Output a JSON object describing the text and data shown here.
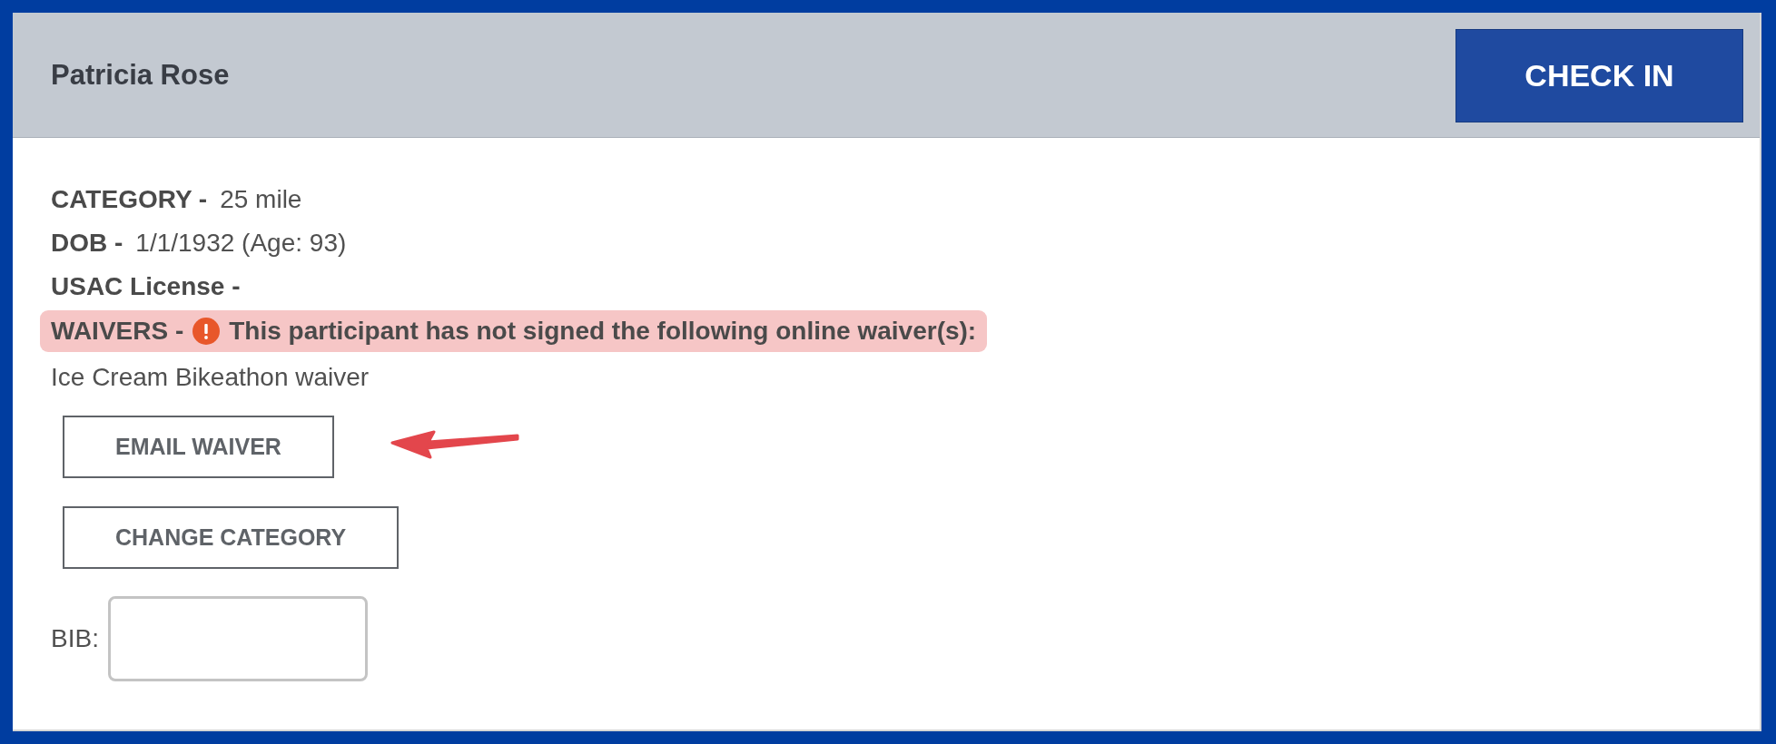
{
  "header": {
    "name": "Patricia Rose",
    "check_in_button": "CHECK IN"
  },
  "details": [
    {
      "label": "CATEGORY -",
      "value": "25 mile"
    },
    {
      "label": "DOB -",
      "value": "1/1/1932 (Age: 93)"
    },
    {
      "label": "USAC License -"
    }
  ],
  "waivers": {
    "label": "WAIVERS -",
    "warning": "This participant has not signed the following online waiver(s):",
    "items": [
      "Ice Cream Bikeathon waiver"
    ]
  },
  "buttons": [
    "EMAIL WAIVER",
    "CHANGE CATEGORY"
  ],
  "bib": {
    "label": "BIB:"
  }
}
